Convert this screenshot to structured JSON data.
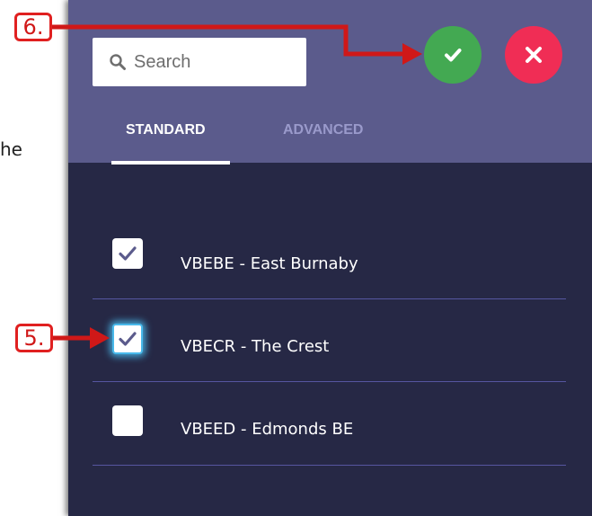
{
  "background": {
    "partial_text": "he"
  },
  "search": {
    "placeholder": "Search",
    "value": ""
  },
  "actions": {
    "confirm_icon": "check-icon",
    "cancel_icon": "close-icon"
  },
  "tabs": [
    {
      "label": "STANDARD",
      "active": true
    },
    {
      "label": "ADVANCED",
      "active": false
    }
  ],
  "items": [
    {
      "label": "VBEBE - East Burnaby",
      "checked": true,
      "focused": false
    },
    {
      "label": "VBECR - The Crest",
      "checked": true,
      "focused": true
    },
    {
      "label": "VBEED - Edmonds BE",
      "checked": false,
      "focused": false
    }
  ],
  "annotations": [
    {
      "label": "6.",
      "target": "confirm-button"
    },
    {
      "label": "5.",
      "target": "checkbox-vbecr"
    }
  ],
  "colors": {
    "panel_bg": "#262845",
    "header_bg": "#5b5b8c",
    "confirm": "#43a952",
    "cancel": "#f02d55",
    "checkmark": "#5b5b8c",
    "annotation": "#e02020",
    "focus_glow": "#49b9ea"
  }
}
